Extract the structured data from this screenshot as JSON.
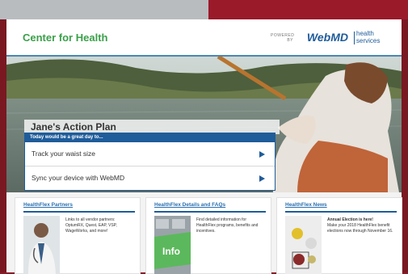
{
  "header": {
    "brand": "Center for Health",
    "logo_powered": "POWERED BY",
    "logo_name": "WebMD",
    "logo_tagline": "health services"
  },
  "plan": {
    "title": "Jane's Action Plan",
    "bar_text": "Today would be a great day to...",
    "items": [
      {
        "label": "Track your waist size"
      },
      {
        "label": "Sync your device with WebMD"
      }
    ]
  },
  "cards": [
    {
      "title": "HealthFlex Partners",
      "text": "Links to all vendor partners: OptumRX, Quest, EAP, VSP, WageWorks, and more!"
    },
    {
      "title": "HealthFlex Details and FAQs",
      "info_key": "Info",
      "text": "Find detailed information for HealthFlex programs, benefits and incentives."
    },
    {
      "title": "HealthFlex News",
      "text_bold": "Annual Election is here!",
      "text": "Make your 2018 HealthFlex benefit elections now through November 16."
    }
  ],
  "colors": {
    "brand_green": "#3aa04a",
    "accent_blue": "#1f5c9a",
    "outer_red": "#8a1a26"
  }
}
